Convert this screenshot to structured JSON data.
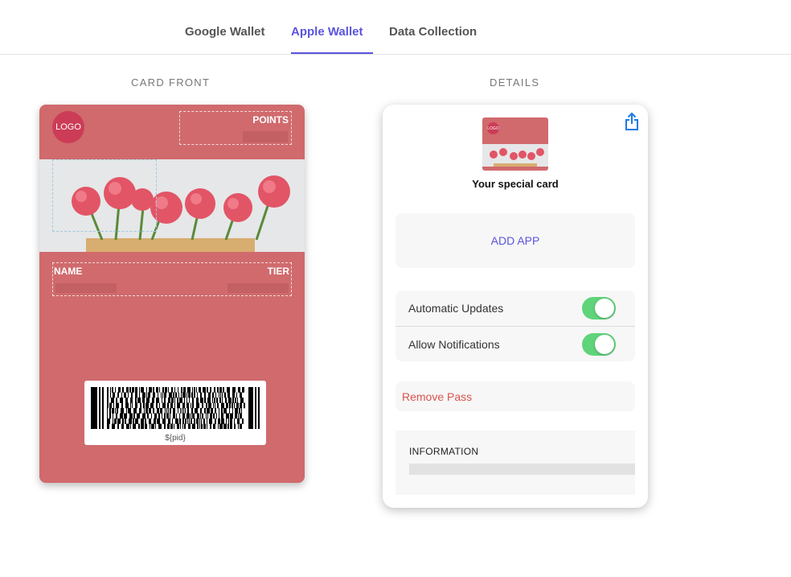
{
  "tabs": [
    {
      "label": "Google Wallet",
      "active": false
    },
    {
      "label": "Apple Wallet",
      "active": true
    },
    {
      "label": "Data Collection",
      "active": false
    }
  ],
  "sections": {
    "card_front": "CARD FRONT",
    "details": "DETAILS"
  },
  "card_front": {
    "logo_text": "LOGO",
    "points_label": "POINTS",
    "name_label": "NAME",
    "tier_label": "TIER",
    "barcode_text": "${pid}",
    "background_color": "#d06a6d"
  },
  "details": {
    "thumbnail_logo_text": "LOGO",
    "card_name": "Your special card",
    "add_app_label": "ADD APP",
    "toggles": [
      {
        "label": "Automatic Updates",
        "on": true
      },
      {
        "label": "Allow Notifications",
        "on": true
      }
    ],
    "remove_pass_label": "Remove Pass",
    "information_label": "INFORMATION",
    "share_icon": "share-icon"
  },
  "colors": {
    "accent": "#5b55dc",
    "toggle_on": "#5fd47b",
    "danger": "#d9534f"
  }
}
